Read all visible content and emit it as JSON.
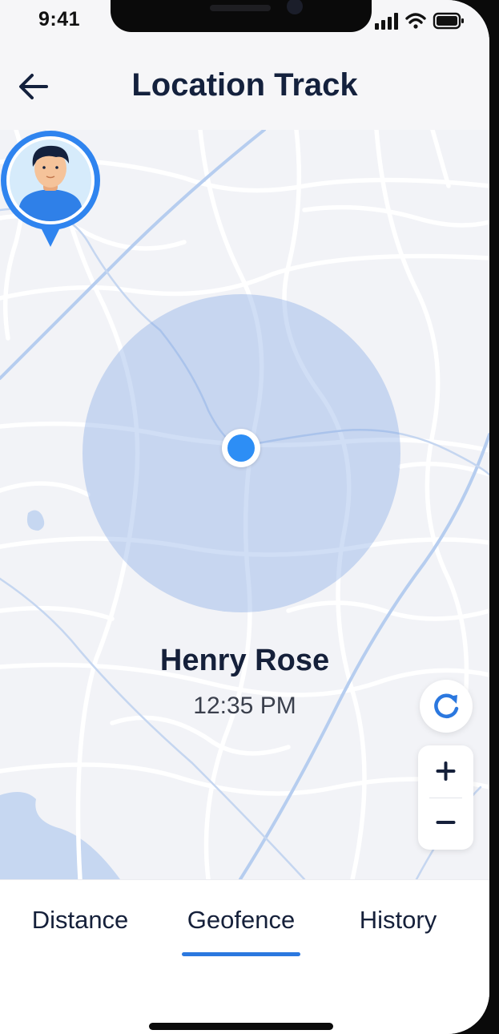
{
  "status_bar": {
    "time": "9:41",
    "icons": [
      "signal-icon",
      "wifi-icon",
      "battery-icon"
    ]
  },
  "header": {
    "title": "Location Track",
    "back_icon": "arrow-left-icon"
  },
  "map": {
    "tracked_user": {
      "name": "Henry Rose",
      "time": "12:35 PM"
    },
    "controls": {
      "refresh_icon": "refresh-icon",
      "zoom_in": "+",
      "zoom_out": "−"
    }
  },
  "tabs": [
    {
      "label": "Distance",
      "active": false
    },
    {
      "label": "Geofence",
      "active": true
    },
    {
      "label": "History",
      "active": false
    }
  ],
  "colors": {
    "accent": "#2b78df",
    "location_dot": "#2d8ef5",
    "geofence_fill": "#a9c2ea",
    "title_text": "#14213d",
    "map_background": "#f2f3f7"
  }
}
